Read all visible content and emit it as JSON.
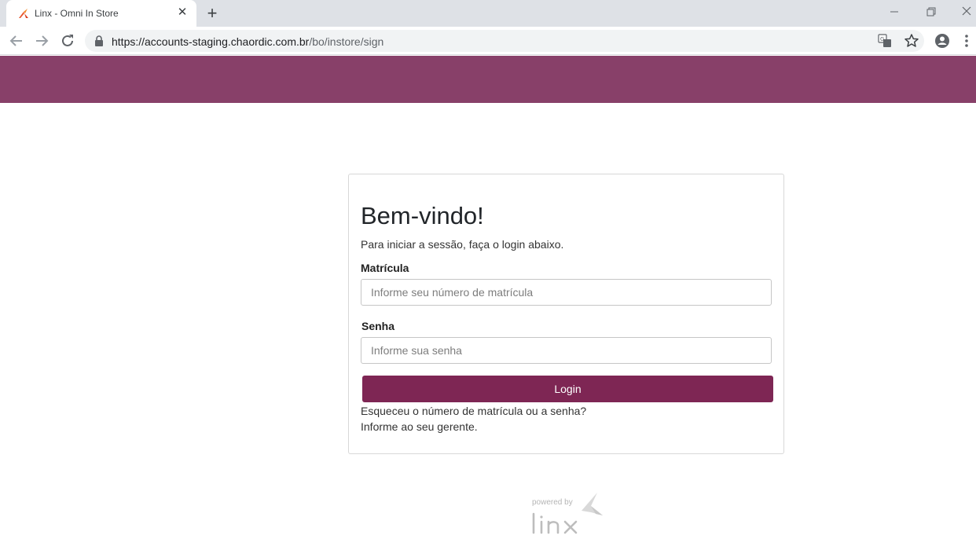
{
  "browser": {
    "tab_title": "Linx - Omni In Store",
    "url_host": "https://accounts-staging.chaordic.com.br",
    "url_path": "/bo/instore/sign"
  },
  "login": {
    "title": "Bem-vindo!",
    "subtitle": "Para iniciar a sessão, faça o login abaixo.",
    "matricula_label": "Matrícula",
    "matricula_placeholder": "Informe seu número de matrícula",
    "senha_label": "Senha",
    "senha_placeholder": "Informe sua senha",
    "button_label": "Login",
    "help_line1": "Esqueceu o número de matrícula ou a senha?",
    "help_line2": "Informe ao seu gerente."
  },
  "footer": {
    "powered_by": "powered by"
  },
  "colors": {
    "header": "#884069",
    "button": "#7e2654"
  },
  "icons": [
    "linx-favicon-icon",
    "close-icon",
    "plus-icon",
    "minimize-icon",
    "restore-icon",
    "window-close-icon",
    "back-icon",
    "forward-icon",
    "reload-icon",
    "lock-icon",
    "translate-icon",
    "star-icon",
    "profile-icon",
    "menu-icon",
    "linx-logo"
  ]
}
